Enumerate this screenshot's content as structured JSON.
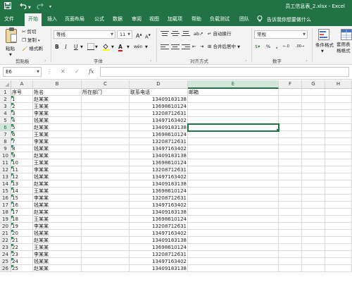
{
  "window": {
    "title": "员工信息表_2.xlsx - Excel"
  },
  "quick_access": {
    "save_icon": "save-icon",
    "undo_icon": "undo-icon",
    "redo_icon": "redo-icon",
    "customize_icon": "customize-qat-icon"
  },
  "tabs": [
    "文件",
    "开始",
    "插入",
    "页面布局",
    "公式",
    "数据",
    "审阅",
    "视图",
    "加载项",
    "帮助",
    "负载测试",
    "团队"
  ],
  "active_tab": "开始",
  "tell_me": "告诉我你想要做什么",
  "ribbon": {
    "clipboard": {
      "paste": "粘贴",
      "cut": "剪切",
      "copy": "复制",
      "format_painter": "格式刷",
      "label": "剪贴板"
    },
    "font": {
      "name": "等线",
      "size": "11",
      "bold": "B",
      "italic": "I",
      "underline": "U",
      "grow": "A",
      "shrink": "A",
      "wen": "wén",
      "label": "字体"
    },
    "alignment": {
      "wrap": "自动换行",
      "merge": "合并后居中",
      "label": "对齐方式"
    },
    "number": {
      "format": "常规",
      "label": "数字"
    },
    "styles": {
      "conditional": "条件格式",
      "table": "套用表格格式"
    }
  },
  "formula_bar": {
    "name_box": "E6",
    "cancel": "✕",
    "enter": "✓",
    "fx": "fx",
    "value": ""
  },
  "sheet": {
    "columns": [
      "A",
      "B",
      "C",
      "D",
      "E",
      "F",
      "G",
      "H"
    ],
    "selected_column": "E",
    "selected_row": 6,
    "header_row": {
      "a": "序号",
      "b": "姓名",
      "c": "所在部门",
      "d": "联系电话",
      "e": "邮箱"
    },
    "rows": [
      {
        "n": "2",
        "a": "1",
        "b": "赵某某",
        "d": "13409183138"
      },
      {
        "n": "3",
        "a": "2",
        "b": "王某某",
        "d": "13698610124"
      },
      {
        "n": "4",
        "a": "3",
        "b": "李某某",
        "d": "13208712631"
      },
      {
        "n": "5",
        "a": "4",
        "b": "钱某某",
        "d": "13497163402"
      },
      {
        "n": "6",
        "a": "5",
        "b": "赵某某",
        "d": "13409183138"
      },
      {
        "n": "7",
        "a": "6",
        "b": "王某某",
        "d": "13698610124"
      },
      {
        "n": "8",
        "a": "7",
        "b": "李某某",
        "d": "13208712631"
      },
      {
        "n": "9",
        "a": "8",
        "b": "钱某某",
        "d": "13497163402"
      },
      {
        "n": "10",
        "a": "9",
        "b": "赵某某",
        "d": "13409183138"
      },
      {
        "n": "11",
        "a": "10",
        "b": "王某某",
        "d": "13698610124"
      },
      {
        "n": "12",
        "a": "11",
        "b": "李某某",
        "d": "13208712631"
      },
      {
        "n": "13",
        "a": "12",
        "b": "钱某某",
        "d": "13497163402"
      },
      {
        "n": "14",
        "a": "13",
        "b": "赵某某",
        "d": "13409183138"
      },
      {
        "n": "15",
        "a": "14",
        "b": "王某某",
        "d": "13698610124"
      },
      {
        "n": "16",
        "a": "15",
        "b": "李某某",
        "d": "13208712631"
      },
      {
        "n": "17",
        "a": "16",
        "b": "钱某某",
        "d": "13497163402"
      },
      {
        "n": "18",
        "a": "17",
        "b": "赵某某",
        "d": "13409183138"
      },
      {
        "n": "19",
        "a": "18",
        "b": "王某某",
        "d": "13698610124"
      },
      {
        "n": "20",
        "a": "19",
        "b": "李某某",
        "d": "13208712631"
      },
      {
        "n": "21",
        "a": "20",
        "b": "钱某某",
        "d": "13497163402"
      },
      {
        "n": "22",
        "a": "21",
        "b": "赵某某",
        "d": "13409183138"
      },
      {
        "n": "23",
        "a": "22",
        "b": "王某某",
        "d": "13698610124"
      },
      {
        "n": "24",
        "a": "23",
        "b": "李某某",
        "d": "13208712631"
      },
      {
        "n": "25",
        "a": "24",
        "b": "钱某某",
        "d": "13497163402"
      },
      {
        "n": "26",
        "a": "25",
        "b": "赵某某",
        "d": "13409183138"
      }
    ]
  },
  "colors": {
    "excel_green": "#217346",
    "error_marker": "#2e8b57",
    "font_color_bar": "#ff0000"
  }
}
